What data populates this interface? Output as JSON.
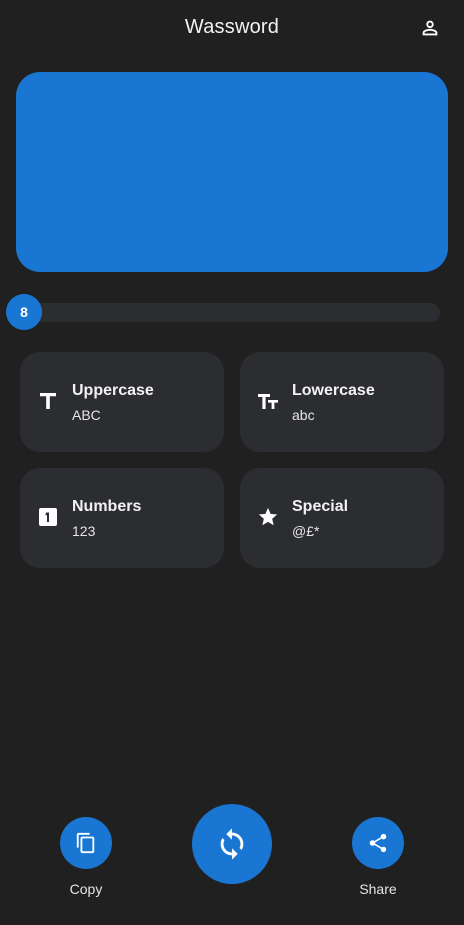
{
  "app": {
    "title": "Wassword",
    "account_icon": "person-outline-icon"
  },
  "password": {
    "value": ""
  },
  "length_slider": {
    "value": 8,
    "min": 8,
    "max": 64,
    "fill_fraction": 0.0
  },
  "options": [
    {
      "label": "Uppercase",
      "sample": "ABC",
      "icon": "text-size-icon"
    },
    {
      "label": "Lowercase",
      "sample": "abc",
      "icon": "text-fields-icon"
    },
    {
      "label": "Numbers",
      "sample": "123",
      "icon": "looks-one-icon"
    },
    {
      "label": "Special",
      "sample": "@£*",
      "icon": "star-icon"
    }
  ],
  "actions": {
    "copy_label": "Copy",
    "share_label": "Share",
    "copy_icon": "copy-icon",
    "share_icon": "share-icon",
    "regenerate_icon": "sync-icon"
  },
  "colors": {
    "accent": "#1976d2",
    "background": "#202020",
    "card": "#2c2d30"
  }
}
